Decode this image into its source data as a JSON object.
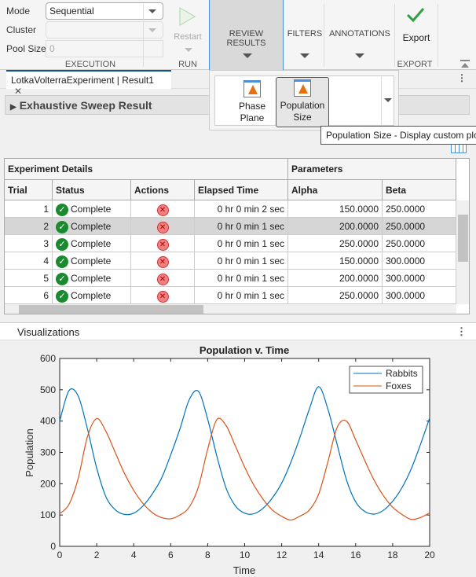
{
  "toolstrip": {
    "execution": {
      "mode_label": "Mode",
      "mode_value": "Sequential",
      "cluster_label": "Cluster",
      "cluster_value": "",
      "pool_label": "Pool Size",
      "pool_value": "0",
      "group": "EXECUTION"
    },
    "run": {
      "restart": "Restart",
      "group": "RUN"
    },
    "review_results": "REVIEW RESULTS",
    "filters": "FILTERS",
    "annotations": "ANNOTATIONS",
    "export": {
      "label": "Export",
      "group": "EXPORT"
    }
  },
  "tab": {
    "title": "LotkaVolterraExperiment | Result1"
  },
  "section": {
    "title": "Exhaustive Sweep Result"
  },
  "gallery": {
    "items": [
      {
        "label1": "Phase",
        "label2": "Plane"
      },
      {
        "label1": "Population",
        "label2": "Size"
      }
    ]
  },
  "tooltip": "Population Size - Display custom plot",
  "table": {
    "groups": [
      "Experiment Details",
      "Parameters"
    ],
    "columns": [
      "Trial",
      "Status",
      "Actions",
      "Elapsed Time",
      "Alpha",
      "Beta"
    ],
    "rows": [
      {
        "trial": "1",
        "status": "Complete",
        "elapsed": "0 hr 0 min 2 sec",
        "alpha": "150.0000",
        "beta": "250.0000"
      },
      {
        "trial": "2",
        "status": "Complete",
        "elapsed": "0 hr 0 min 1 sec",
        "alpha": "200.0000",
        "beta": "250.0000"
      },
      {
        "trial": "3",
        "status": "Complete",
        "elapsed": "0 hr 0 min 1 sec",
        "alpha": "250.0000",
        "beta": "250.0000"
      },
      {
        "trial": "4",
        "status": "Complete",
        "elapsed": "0 hr 0 min 1 sec",
        "alpha": "150.0000",
        "beta": "300.0000"
      },
      {
        "trial": "5",
        "status": "Complete",
        "elapsed": "0 hr 0 min 1 sec",
        "alpha": "200.0000",
        "beta": "300.0000"
      },
      {
        "trial": "6",
        "status": "Complete",
        "elapsed": "0 hr 0 min 1 sec",
        "alpha": "250.0000",
        "beta": "300.0000"
      }
    ],
    "selected_row": 1
  },
  "visualizations": {
    "title": "Visualizations"
  },
  "chart_data": {
    "type": "line",
    "title": "Population v. Time",
    "xlabel": "Time",
    "ylabel": "Population",
    "xlim": [
      0,
      20
    ],
    "ylim": [
      0,
      600
    ],
    "xticks": [
      0,
      2,
      4,
      6,
      8,
      10,
      12,
      14,
      16,
      18,
      20
    ],
    "yticks": [
      0,
      100,
      200,
      300,
      400,
      500,
      600
    ],
    "legend": "top-right",
    "x": [
      0,
      0.5,
      1,
      1.5,
      2,
      2.5,
      3,
      3.5,
      4,
      4.5,
      5,
      5.5,
      6,
      6.5,
      7,
      7.5,
      8,
      8.5,
      9,
      9.5,
      10,
      10.5,
      11,
      11.5,
      12,
      12.5,
      13,
      13.5,
      14,
      14.5,
      15,
      15.5,
      16,
      16.5,
      17,
      17.5,
      18,
      18.5,
      19,
      19.5,
      20
    ],
    "series": [
      {
        "name": "Rabbits",
        "color": "#0072bd",
        "values": [
          400,
          497,
          480,
          375,
          250,
          158,
          117,
          102,
          106,
          129,
          167,
          217,
          292,
          375,
          468,
          495,
          406,
          287,
          185,
          129,
          106,
          104,
          122,
          155,
          202,
          269,
          350,
          439,
          510,
          438,
          325,
          213,
          142,
          111,
          103,
          115,
          144,
          187,
          247,
          325,
          410
        ]
      },
      {
        "name": "Foxes",
        "color": "#d95319",
        "values": [
          104,
          134,
          217,
          350,
          408,
          367,
          300,
          233,
          179,
          137,
          108,
          92,
          88,
          100,
          125,
          190,
          310,
          405,
          385,
          320,
          253,
          195,
          150,
          116,
          96,
          84,
          97,
          116,
          167,
          270,
          380,
          400,
          340,
          273,
          211,
          162,
          125,
          102,
          86,
          92,
          107
        ]
      }
    ]
  }
}
